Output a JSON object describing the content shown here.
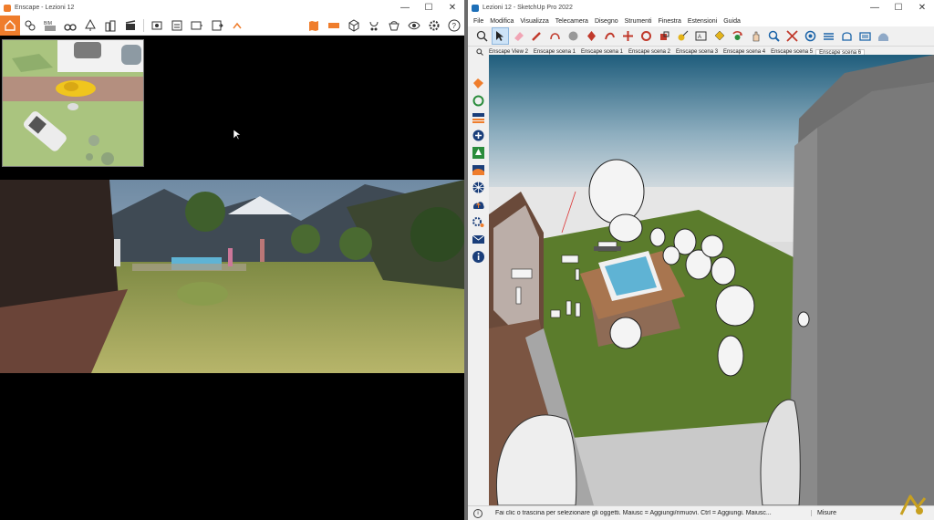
{
  "enscape": {
    "title": "Enscape - Lezioni 12",
    "controls": {
      "minimize": "—",
      "maximize": "☐",
      "close": "✕"
    },
    "toolbar": [
      {
        "name": "home-icon",
        "active": true
      },
      {
        "name": "link-icon"
      },
      {
        "name": "bim-icon",
        "label": "BIM"
      },
      {
        "name": "binoculars-icon"
      },
      {
        "name": "tree-icon"
      },
      {
        "name": "building-icon"
      },
      {
        "name": "clapper-icon"
      },
      {
        "name": "screenshot-icon"
      },
      {
        "name": "batch-render-icon"
      },
      {
        "name": "export-icon"
      },
      {
        "name": "export-360-icon"
      },
      {
        "name": "collapse-icon"
      }
    ],
    "toolbar_right": [
      {
        "name": "map-icon"
      },
      {
        "name": "panorama-icon"
      },
      {
        "name": "cube-icon"
      },
      {
        "name": "vr-icon"
      },
      {
        "name": "asset-library-icon"
      },
      {
        "name": "visibility-icon"
      },
      {
        "name": "settings-icon"
      },
      {
        "name": "help-icon"
      }
    ],
    "bim_label": "BIM",
    "help_label": "?"
  },
  "sketchup": {
    "title": "Lezioni 12 - SketchUp Pro 2022",
    "controls": {
      "minimize": "—",
      "maximize": "☐",
      "close": "✕"
    },
    "menu": [
      "File",
      "Modifica",
      "Visualizza",
      "Telecamera",
      "Disegno",
      "Strumenti",
      "Finestra",
      "Estensioni",
      "Guida"
    ],
    "scene_tabs": [
      "Enscape View 2",
      "Enscape scena 1",
      "Enscape scena 1",
      "Enscape scena 2",
      "Enscape scena 3",
      "Enscape scena 4",
      "Enscape scena 5",
      "Enscape scena 6"
    ],
    "active_tab_index": 7,
    "status_hint": "Fai clic o trascina per selezionare gli oggetti. Maiusc = Aggiungi/rimuovi. Ctrl = Aggiungi. Maiusc...",
    "status_measure": "Misure",
    "status_info": "i",
    "colors": {
      "accent": "#ef7d2c",
      "sky_top": "#2a6a8a",
      "grass": "#5b7c2c",
      "pool": "#5fb3d4"
    }
  }
}
